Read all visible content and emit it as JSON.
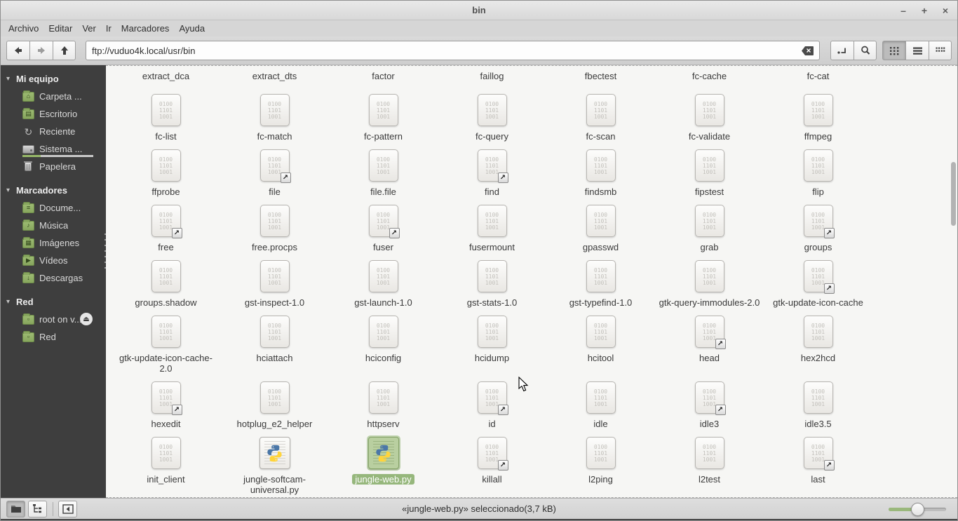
{
  "window": {
    "title": "bin",
    "minimize": "–",
    "maximize": "+",
    "close": "×"
  },
  "menubar": {
    "items": [
      "Archivo",
      "Editar",
      "Ver",
      "Ir",
      "Marcadores",
      "Ayuda"
    ]
  },
  "toolbar": {
    "location": "ftp://vuduo4k.local/usr/bin"
  },
  "sidebar": {
    "collapse_glyph": "▾",
    "eject_glyph": "⏏",
    "sections": [
      {
        "label": "Mi equipo",
        "items": [
          {
            "label": "Carpeta ...",
            "icon": "home-folder-icon",
            "glyph": "⌂"
          },
          {
            "label": "Escritorio",
            "icon": "desktop-icon",
            "glyph": "▤"
          },
          {
            "label": "Reciente",
            "icon": "recent-icon",
            "glyph": "↻"
          },
          {
            "label": "Sistema ...",
            "icon": "drive-icon",
            "glyph": "",
            "usage_bar": true
          },
          {
            "label": "Papelera",
            "icon": "trash-icon",
            "glyph": ""
          }
        ]
      },
      {
        "label": "Marcadores",
        "items": [
          {
            "label": "Docume...",
            "icon": "documents-folder-icon",
            "glyph": "≡"
          },
          {
            "label": "Música",
            "icon": "music-folder-icon",
            "glyph": "♪"
          },
          {
            "label": "Imágenes",
            "icon": "pictures-folder-icon",
            "glyph": "▦"
          },
          {
            "label": "Vídeos",
            "icon": "videos-folder-icon",
            "glyph": "▶"
          },
          {
            "label": "Descargas",
            "icon": "downloads-folder-icon",
            "glyph": "↓"
          }
        ]
      },
      {
        "label": "Red",
        "items": [
          {
            "label": "root on v...",
            "icon": "remote-folder-icon",
            "glyph": "▫",
            "eject": true
          },
          {
            "label": "Red",
            "icon": "network-folder-icon",
            "glyph": "▫"
          }
        ]
      }
    ]
  },
  "files": {
    "binary_icon_lines": [
      "0100",
      "1101",
      "1001"
    ],
    "symlink_arrow": "↗",
    "rows": [
      {
        "partial": true,
        "items": [
          {
            "name": "extract_dca"
          },
          {
            "name": "extract_dts"
          },
          {
            "name": "factor"
          },
          {
            "name": "faillog"
          },
          {
            "name": "fbectest"
          },
          {
            "name": "fc-cache"
          },
          {
            "name": "fc-cat"
          }
        ]
      },
      {
        "items": [
          {
            "name": "fc-list"
          },
          {
            "name": "fc-match"
          },
          {
            "name": "fc-pattern"
          },
          {
            "name": "fc-query"
          },
          {
            "name": "fc-scan"
          },
          {
            "name": "fc-validate"
          },
          {
            "name": "ffmpeg"
          }
        ]
      },
      {
        "items": [
          {
            "name": "ffprobe"
          },
          {
            "name": "file",
            "link": true
          },
          {
            "name": "file.file"
          },
          {
            "name": "find",
            "link": true
          },
          {
            "name": "findsmb"
          },
          {
            "name": "fipstest"
          },
          {
            "name": "flip"
          }
        ]
      },
      {
        "items": [
          {
            "name": "free",
            "link": true
          },
          {
            "name": "free.procps"
          },
          {
            "name": "fuser",
            "link": true
          },
          {
            "name": "fusermount"
          },
          {
            "name": "gpasswd"
          },
          {
            "name": "grab"
          },
          {
            "name": "groups",
            "link": true
          }
        ]
      },
      {
        "items": [
          {
            "name": "groups.shadow"
          },
          {
            "name": "gst-inspect-1.0"
          },
          {
            "name": "gst-launch-1.0"
          },
          {
            "name": "gst-stats-1.0"
          },
          {
            "name": "gst-typefind-1.0"
          },
          {
            "name": "gtk-query-immodules-2.0"
          },
          {
            "name": "gtk-update-icon-cache",
            "link": true
          }
        ]
      },
      {
        "items": [
          {
            "name": "gtk-update-icon-cache-2.0"
          },
          {
            "name": "hciattach"
          },
          {
            "name": "hciconfig"
          },
          {
            "name": "hcidump"
          },
          {
            "name": "hcitool"
          },
          {
            "name": "head",
            "link": true
          },
          {
            "name": "hex2hcd"
          }
        ]
      },
      {
        "items": [
          {
            "name": "hexedit",
            "link": true
          },
          {
            "name": "hotplug_e2_helper"
          },
          {
            "name": "httpserv"
          },
          {
            "name": "id",
            "link": true
          },
          {
            "name": "idle"
          },
          {
            "name": "idle3",
            "link": true
          },
          {
            "name": "idle3.5"
          }
        ]
      },
      {
        "items": [
          {
            "name": "init_client"
          },
          {
            "name": "jungle-softcam-universal.py",
            "type": "python"
          },
          {
            "name": "jungle-web.py",
            "type": "python",
            "selected": true
          },
          {
            "name": "killall",
            "link": true
          },
          {
            "name": "l2ping"
          },
          {
            "name": "l2test"
          },
          {
            "name": "last",
            "link": true
          }
        ]
      }
    ]
  },
  "statusbar": {
    "text": "«jungle-web.py» seleccionado(3,7 kB)",
    "zoom_slider_fraction": 0.5
  },
  "colors": {
    "selection_green": "#96b77c",
    "sidebar_bg": "#3e3e3e",
    "accent_green": "#9ab87c"
  }
}
